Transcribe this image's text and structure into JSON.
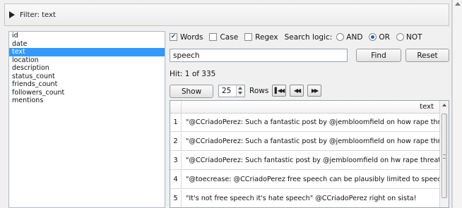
{
  "filter": {
    "title": "Filter: text"
  },
  "attributes": [
    {
      "label": "id",
      "selected": false
    },
    {
      "label": "date",
      "selected": false
    },
    {
      "label": "text",
      "selected": true
    },
    {
      "label": "location",
      "selected": false
    },
    {
      "label": "description",
      "selected": false
    },
    {
      "label": "status_count",
      "selected": false
    },
    {
      "label": "friends_count",
      "selected": false
    },
    {
      "label": "followers_count",
      "selected": false
    },
    {
      "label": "mentions",
      "selected": false
    }
  ],
  "options": {
    "words": {
      "label": "Words",
      "checked": true
    },
    "case": {
      "label": "Case",
      "checked": false
    },
    "regex": {
      "label": "Regex",
      "checked": false
    },
    "search_logic_label": "Search logic:",
    "and": {
      "label": "AND",
      "selected": false
    },
    "or": {
      "label": "OR",
      "selected": true
    },
    "not": {
      "label": "NOT",
      "selected": false
    }
  },
  "query": {
    "value": "speech",
    "find_label": "Find",
    "reset_label": "Reset"
  },
  "hits": {
    "text": "Hit: 1  of  335"
  },
  "paging": {
    "show_label": "Show",
    "rows_value": "25",
    "rows_label": "Rows"
  },
  "table": {
    "column_header": "text",
    "rows": [
      {
        "num": "1",
        "text": "\"@CCriadoPerez: Such a fantastic post by @jembloomfield on how rape threa"
      },
      {
        "num": "2",
        "text": "\"@CCriadoPerez: Such a fantastic post by @jembloomfield on how rape threa"
      },
      {
        "num": "3",
        "text": "\"@CCriadoPerez: Such fantastic post by @jembloomfield on hw rape threats a"
      },
      {
        "num": "4",
        "text": "\"@toecrease: @CCriadoPerez free speech can be plausibly limited to speech th"
      },
      {
        "num": "5",
        "text": "\"It's not free speech it's hate speech\" @CCriadoPerez right on sista!"
      }
    ]
  }
}
